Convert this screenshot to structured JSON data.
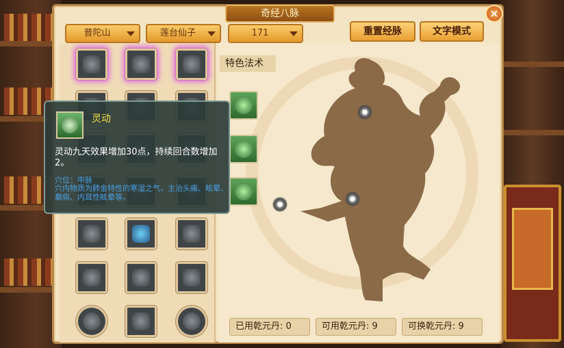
{
  "window": {
    "title": "奇经八脉"
  },
  "toolbar": {
    "dropdowns": [
      {
        "value": "普陀山"
      },
      {
        "value": "莲台仙子"
      },
      {
        "value": "171"
      }
    ],
    "reset_label": "重置经脉",
    "text_mode_label": "文字模式"
  },
  "special": {
    "section_label": "特色法术"
  },
  "tooltip": {
    "skill_name": "灵动",
    "description": "灵动九天效果增加30点，持续回合数增加2。",
    "acupoint_label": "穴位：申脉",
    "acupoint_desc": "穴内物质为肺金特性的寒湿之气，主治头痛、眩晕、癫痫、内耳性眩晕等。"
  },
  "stats": {
    "used": "已用乾元丹: 0",
    "available": "可用乾元丹: 9",
    "exchangeable": "可换乾元丹: 9"
  },
  "colors": {
    "panel_bg": "#f3e4c4",
    "accent_orange": "#e39a2a",
    "tooltip_title": "#f5e04a",
    "tooltip_acupoint": "#4a9ee0",
    "silhouette": "#8b6a48"
  },
  "icons": [
    "close-icon",
    "skill-icon",
    "acupoint-icon"
  ]
}
